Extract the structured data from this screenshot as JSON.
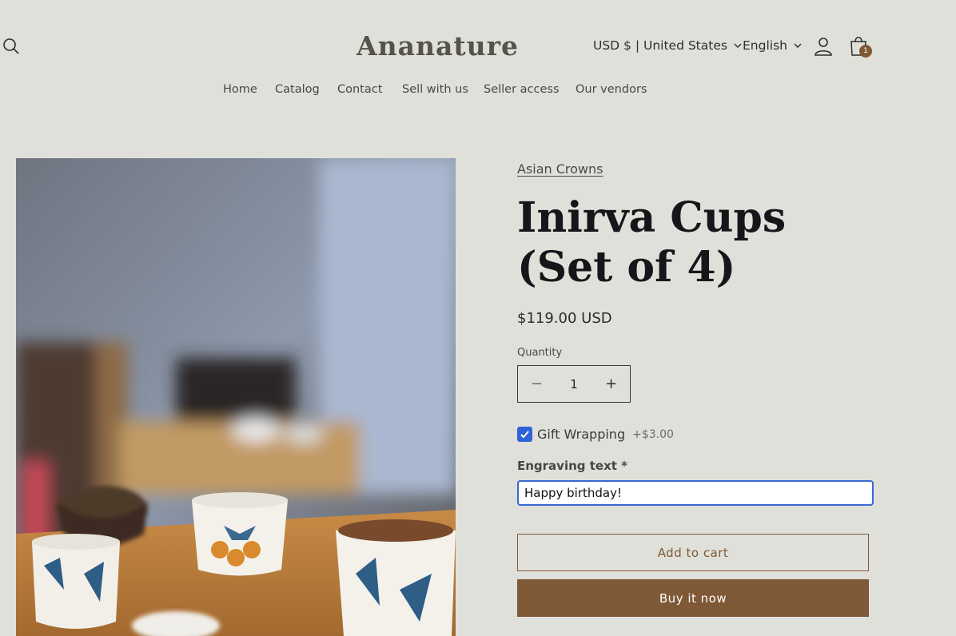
{
  "header": {
    "logo": "Ananature",
    "currency": "USD $ | United States",
    "language": "English",
    "cart_count": "1"
  },
  "nav": {
    "items": [
      "Home",
      "Catalog",
      "Contact",
      "Sell with us",
      "Seller access",
      "Our vendors"
    ]
  },
  "product": {
    "vendor": "Asian Crowns",
    "title_line1": "Inirva Cups",
    "title_line2": "(Set of 4)",
    "price": "$119.00 USD",
    "quantity_label": "Quantity",
    "quantity": "1",
    "gift_wrapping_label": "Gift Wrapping",
    "gift_wrapping_price": "+$3.00",
    "gift_wrapping_checked": true,
    "engraving_label": "Engraving text *",
    "engraving_value": "Happy birthday!",
    "add_to_cart": "Add to cart",
    "buy_now": "Buy it now"
  },
  "colors": {
    "background": "#e0e0da",
    "accent": "#7f5835",
    "focus": "#3869d4"
  }
}
